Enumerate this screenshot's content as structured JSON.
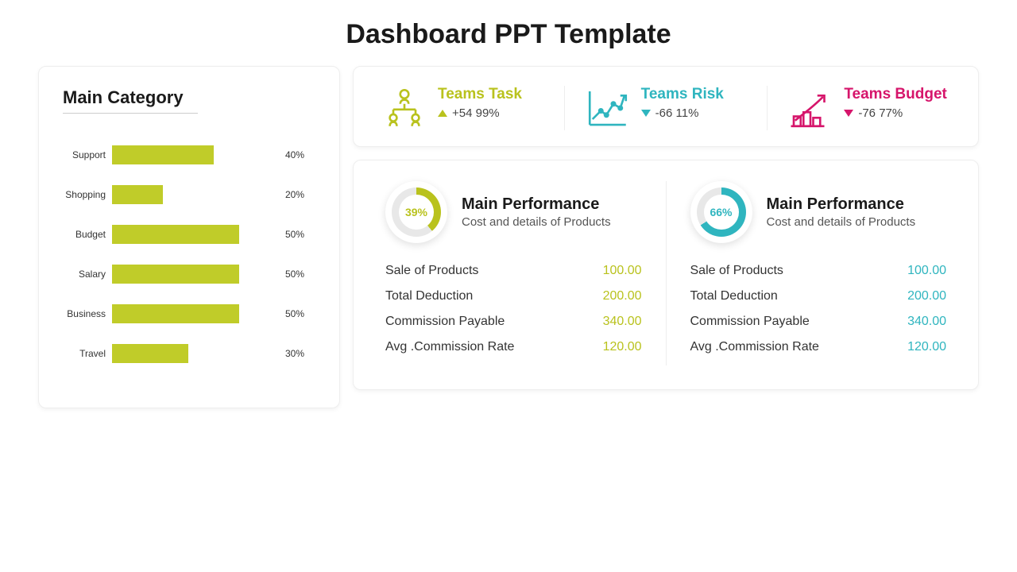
{
  "title": "Dashboard PPT Template",
  "colors": {
    "olive": "#c0cc29",
    "oliveText": "#b9c21d",
    "teal": "#2fb5bf",
    "pink": "#d6156b"
  },
  "category": {
    "heading": "Main Category",
    "items": [
      {
        "label": "Support",
        "value": 40,
        "text": "40%"
      },
      {
        "label": "Shopping",
        "value": 20,
        "text": "20%"
      },
      {
        "label": "Budget",
        "value": 50,
        "text": "50%"
      },
      {
        "label": "Salary",
        "value": 50,
        "text": "50%"
      },
      {
        "label": "Business",
        "value": 50,
        "text": "50%"
      },
      {
        "label": "Travel",
        "value": 30,
        "text": "30%"
      }
    ]
  },
  "kpis": [
    {
      "title": "Teams  Task",
      "delta": "+54   99%",
      "trend": "up",
      "color": "olive"
    },
    {
      "title": "Teams  Risk",
      "delta": "-66   11%",
      "trend": "down",
      "color": "teal"
    },
    {
      "title": "Teams  Budget",
      "delta": "-76   77%",
      "trend": "down",
      "color": "pink"
    }
  ],
  "performance": [
    {
      "percent": 39,
      "percentText": "39%",
      "color": "olive",
      "title": "Main  Performance",
      "subtitle": "Cost and details of Products",
      "rows": [
        {
          "label": "Sale of Products",
          "value": "100.00"
        },
        {
          "label": "Total Deduction",
          "value": "200.00"
        },
        {
          "label": "Commission Payable",
          "value": "340.00"
        },
        {
          "label": "Avg .Commission Rate",
          "value": "120.00"
        }
      ]
    },
    {
      "percent": 66,
      "percentText": "66%",
      "color": "teal",
      "title": "Main  Performance",
      "subtitle": "Cost and details of Products",
      "rows": [
        {
          "label": "Sale of Products",
          "value": "100.00"
        },
        {
          "label": "Total Deduction",
          "value": "200.00"
        },
        {
          "label": "Commission Payable",
          "value": "340.00"
        },
        {
          "label": "Avg .Commission Rate",
          "value": "120.00"
        }
      ]
    }
  ],
  "chart_data": {
    "type": "bar",
    "orientation": "horizontal",
    "title": "Main Category",
    "categories": [
      "Support",
      "Shopping",
      "Budget",
      "Salary",
      "Business",
      "Travel"
    ],
    "values": [
      40,
      20,
      50,
      50,
      50,
      30
    ],
    "xlabel": "",
    "ylabel": "",
    "xlim": [
      0,
      100
    ]
  }
}
